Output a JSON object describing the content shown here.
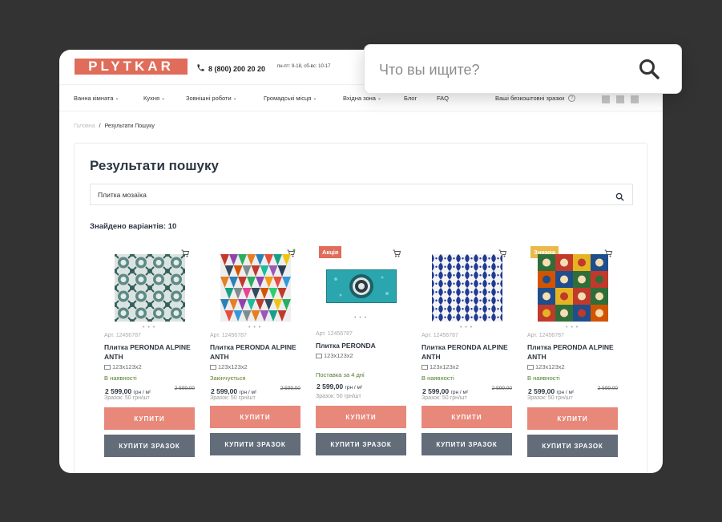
{
  "header": {
    "logo": "PLYTKAR",
    "phone": "8 (800) 200 20 20",
    "hours": "пн-пт: 9-18, сб-вс: 10-17"
  },
  "nav": {
    "items": [
      {
        "label": "Ванна кімната",
        "dropdown": true
      },
      {
        "label": "Кухня",
        "dropdown": true
      },
      {
        "label": "Зовнішні роботи",
        "dropdown": true
      },
      {
        "label": "Громадські місця",
        "dropdown": true
      },
      {
        "label": "Вхідна зона",
        "dropdown": true
      },
      {
        "label": "Блог",
        "dropdown": false
      },
      {
        "label": "FAQ",
        "dropdown": false
      }
    ],
    "samples": "Ваші безкоштовні зразки",
    "help": "?"
  },
  "breadcrumb": {
    "home": "Головна",
    "sep": "/",
    "current": "Результати Пошуку"
  },
  "search": {
    "title": "Результати пошуку",
    "query": "Плитка мозаїка",
    "found": "Знайдено варіантів: 10"
  },
  "products": [
    {
      "badge": "",
      "art": "Арт. 12456787",
      "name": "Плитка PERONDA ALPINE ANTH",
      "size": "123x123x2",
      "status": "В наявності",
      "price": "2 599,00",
      "unit": "грн / м²",
      "old": "2 599,00",
      "sample": "Зразок: 50 грн/шт",
      "buy": "КУПИТИ",
      "buy_sample": "КУПИТИ ЗРАЗОК"
    },
    {
      "badge": "",
      "art": "Арт. 12456787",
      "name": "Плитка PERONDA ALPINE ANTH",
      "size": "123x123x2",
      "status": "Закінчується",
      "price": "2 599,00",
      "unit": "грн / м²",
      "old": "2 599,00",
      "sample": "Зразок: 50 грн/шт",
      "buy": "КУПИТИ",
      "buy_sample": "КУПИТИ ЗРАЗОК"
    },
    {
      "badge": "Акція",
      "art": "Арт. 12456787",
      "name": "Плитка PERONDA",
      "size": "123x123x2",
      "status": "Поставка за 4 дні",
      "price": "2 599,00",
      "unit": "грн / м²",
      "old": "",
      "sample": "Зразок: 50 грн/шт",
      "buy": "КУПИТИ",
      "buy_sample": "КУПИТИ ЗРАЗОК"
    },
    {
      "badge": "",
      "art": "Арт. 12456787",
      "name": "Плитка PERONDA ALPINE ANTH",
      "size": "123x123x2",
      "status": "В наявності",
      "price": "2 599,00",
      "unit": "грн / м²",
      "old": "2 599,00",
      "sample": "Зразок: 50 грн/шт",
      "buy": "КУПИТИ",
      "buy_sample": "КУПИТИ ЗРАЗОК"
    },
    {
      "badge": "Знижка",
      "art": "Арт. 12456787",
      "name": "Плитка PERONDA ALPINE ANTH",
      "size": "123x123x2",
      "status": "В наявності",
      "price": "2 599,00",
      "unit": "грн / м²",
      "old": "2 599,00",
      "sample": "Зразок: 50 грн/шт",
      "buy": "КУПИТИ",
      "buy_sample": "КУПИТИ ЗРАЗОК"
    }
  ],
  "popup": {
    "placeholder": "Что вы ищите?"
  },
  "colors": {
    "brand": "#e06c5a",
    "buy_button": "#e8887a",
    "sample_button": "#636c79",
    "badge_sale": "#e06c5a",
    "badge_discount": "#e9b949",
    "status_green": "#4e7d2a"
  },
  "icons": {
    "phone": "phone-icon",
    "search": "search-icon",
    "cart": "cart-icon",
    "dimensions": "dimensions-icon"
  }
}
